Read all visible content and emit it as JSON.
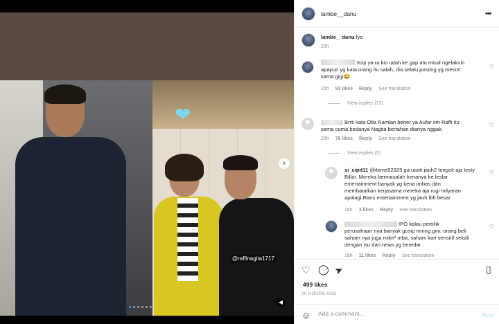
{
  "media": {
    "photo_tag": "@raffinagita1717",
    "next_icon": "›",
    "sound_icon": "◀",
    "heart_sticker": "❤"
  },
  "header": {
    "username": "lambe__danu",
    "more_icon": "•••"
  },
  "caption": {
    "username": "lambe__danu",
    "text": "lya",
    "time": "20h"
  },
  "comments": [
    {
      "text_line1": "Knp ya ra kio udah ke gap ato misal ngelakuin",
      "text_line2": "apapun yg kata orang itu salah, dia selalu posting yg mesra\"",
      "text_line3": "sama gigi😂",
      "time": "20h",
      "likes": "93 likes",
      "reply": "Reply",
      "translate": "See translation",
      "view_replies": "View replies (23)"
    },
    {
      "text_line1": "Brrti kata Olla Ramlan bener ya Aufar sm Raffi itu",
      "text_line2": "sama cuma bedanya Nagita bertahan dianya nggak.",
      "time": "20h",
      "likes": "76 likes",
      "reply": "Reply",
      "translate": "See translation",
      "view_replies": "View replies (5)"
    }
  ],
  "replies": [
    {
      "username": "si_cipit11",
      "text_line1": "@itsme92929 ga usah jauh2 tengok aja lesty",
      "text_line2": "Billar. Mereka bermasalah kenanya ke leslar",
      "text_line3": "entertainment banyak yg kena imbas dan",
      "text_line4": "membatalkan kerjasama mereka aja rugi milyaran",
      "text_line5": "apalagi Rans entertainment yg jauh lbh besar",
      "time": "18h",
      "likes": "3 likes",
      "reply": "Reply",
      "translate": "See translation"
    },
    {
      "text_line1": "IPO kalau pemilik",
      "text_line2": "perusahaan nya banyak gosip miring gini, orang beli",
      "text_line3": "saham nya juga mikir² mba, saham kan sensitif sekali",
      "text_line4": "dengan isu dan news yg beredar .",
      "time": "18h",
      "likes": "11 likes",
      "reply": "Reply",
      "translate": "See translation"
    }
  ],
  "actions": {
    "like_icon": "♡",
    "comment_icon": "◯",
    "share_icon": "➤",
    "save_icon": "▯",
    "likes": "499 likes",
    "time": "20 HOURS AGO"
  },
  "add_comment": {
    "emoji_icon": "☺",
    "placeholder": "Add a comment...",
    "post_label": "Post"
  }
}
